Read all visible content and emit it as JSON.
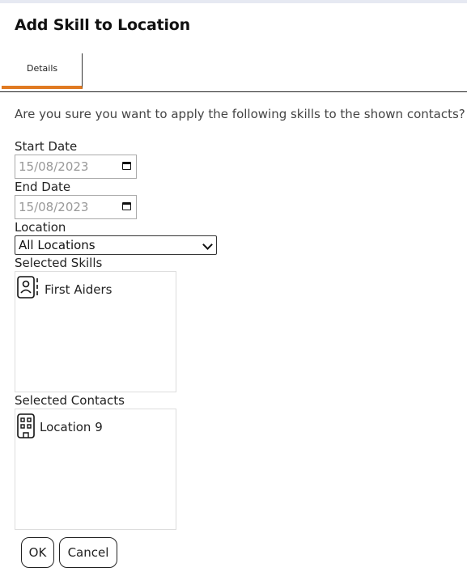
{
  "dialog": {
    "title": "Add Skill to Location",
    "tabs": [
      {
        "label": "Details",
        "active": true
      }
    ],
    "prompt": "Are you sure you want to apply the following skills to the shown contacts?"
  },
  "form": {
    "start_date": {
      "label": "Start Date",
      "value": "15/08/2023"
    },
    "end_date": {
      "label": "End Date",
      "value": "15/08/2023"
    },
    "location": {
      "label": "Location",
      "selected": "All Locations"
    },
    "selected_skills": {
      "label": "Selected Skills",
      "items": [
        {
          "label": "First Aiders",
          "icon": "person-badge-icon"
        }
      ]
    },
    "selected_contacts": {
      "label": "Selected Contacts",
      "items": [
        {
          "label": "Location 9",
          "icon": "building-icon"
        }
      ]
    }
  },
  "buttons": {
    "ok": "OK",
    "cancel": "Cancel"
  },
  "colors": {
    "tab_accent": "#e07a22",
    "top_bar": "#e6e9f2"
  }
}
